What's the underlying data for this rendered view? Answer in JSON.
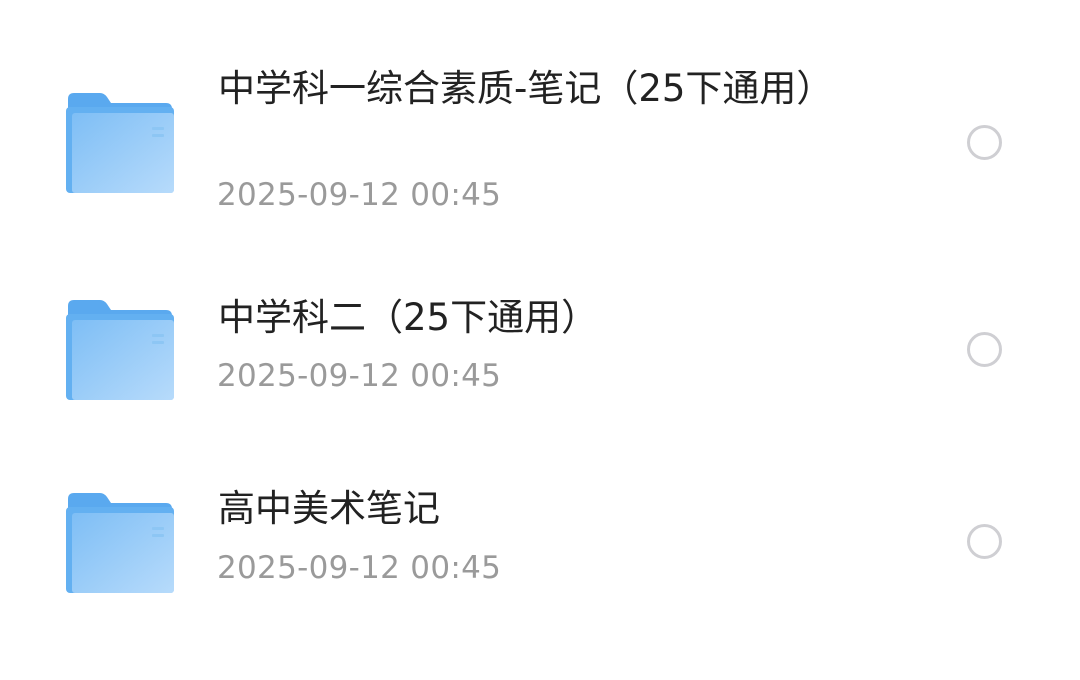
{
  "files": [
    {
      "name": "中学科一综合素质-笔记（25下通用）",
      "date": "2025-09-12 00:45",
      "icon": "folder-icon",
      "selected": false
    },
    {
      "name": "中学科二（25下通用）",
      "date": "2025-09-12 00:45",
      "icon": "folder-icon",
      "selected": false
    },
    {
      "name": "高中美术笔记",
      "date": "2025-09-12 00:45",
      "icon": "folder-icon",
      "selected": false
    }
  ],
  "colors": {
    "folder_back": "#5aa9ef",
    "folder_front_light": "#b9dcfb",
    "folder_front_dark": "#7bbdf4",
    "name_text": "#222222",
    "date_text": "#9a9a9a",
    "radio_border": "#cfcfd3"
  }
}
